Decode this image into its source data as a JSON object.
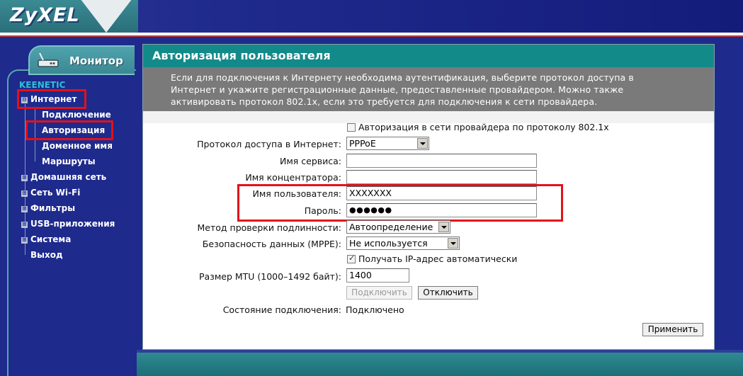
{
  "brand": {
    "logo": "ZyXEL",
    "product": "KEENETIC"
  },
  "monitor_tab": {
    "label": "Монитор",
    "icon": "router-icon"
  },
  "sidebar": {
    "items": [
      {
        "label": "Интернет",
        "expander": "⊟"
      },
      {
        "label": "Подключение"
      },
      {
        "label": "Авторизация"
      },
      {
        "label": "Доменное имя"
      },
      {
        "label": "Маршруты"
      },
      {
        "label": "Домашняя сеть",
        "expander": "⊞"
      },
      {
        "label": "Сеть Wi-Fi",
        "expander": "⊞"
      },
      {
        "label": "Фильтры",
        "expander": "⊞"
      },
      {
        "label": "USB-приложения",
        "expander": "⊞"
      },
      {
        "label": "Система",
        "expander": "⊞"
      },
      {
        "label": "Выход"
      }
    ]
  },
  "page": {
    "title": "Авторизация пользователя",
    "description": [
      "Если для подключения к Интернету необходима аутентификация, выберите протокол доступа в",
      "Интернет и укажите регистрационные данные, предоставленные провайдером. Можно также",
      "активировать протокол 802.1x, если это требуется для подключения к сети провайдера."
    ]
  },
  "form": {
    "auth_8021x_label": "Авторизация в сети провайдера по протоколу 802.1x",
    "protocol": {
      "label": "Протокол доступа в Интернет:",
      "value": "PPPoE"
    },
    "service_name": {
      "label": "Имя сервиса:",
      "value": ""
    },
    "concentrator_name": {
      "label": "Имя концентратора:",
      "value": ""
    },
    "username": {
      "label": "Имя пользователя:",
      "value": "XXXXXXX"
    },
    "password": {
      "label": "Пароль:",
      "value": "●●●●●●"
    },
    "auth_method": {
      "label": "Метод проверки подлинности:",
      "value": "Автоопределение"
    },
    "mppe": {
      "label": "Безопасность данных (MPPE):",
      "value": "Не используется"
    },
    "auto_ip_label": "Получать IP-адрес автоматически",
    "mtu": {
      "label": "Размер MTU (1000–1492 байт):",
      "value": "1400"
    },
    "connect_label": "Подключить",
    "disconnect_label": "Отключить",
    "status": {
      "label": "Состояние подключения:",
      "value": "Подключено"
    },
    "apply_label": "Применить"
  },
  "colors": {
    "highlight": "#e0121a",
    "header_teal": "#138a8a",
    "nav_blue": "#1e2a8c"
  }
}
